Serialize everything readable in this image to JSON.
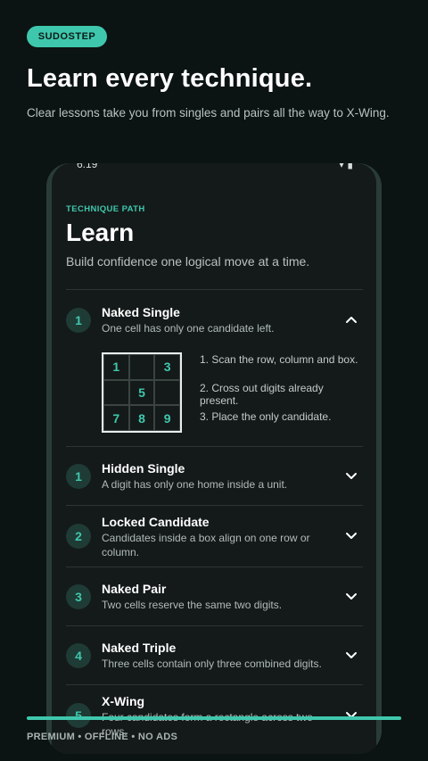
{
  "promo": {
    "badge": "SUDOSTEP",
    "headline": "Learn every technique.",
    "subhead": "Clear lessons take you from singles and pairs all the way to X-Wing.",
    "footer": "PREMIUM • OFFLINE • NO ADS",
    "progress": 1.0
  },
  "status_bar": {
    "time": "6:19",
    "icons": "▾ ▮"
  },
  "screen": {
    "eyebrow": "TECHNIQUE PATH",
    "title": "Learn",
    "subtitle": "Build confidence one logical move at a time.",
    "techniques": [
      {
        "number": "1",
        "title": "Naked Single",
        "description": "One cell has only one candidate left.",
        "expanded": true,
        "grid": [
          "1",
          "",
          "3",
          "",
          "5",
          "",
          "7",
          "8",
          "9"
        ],
        "steps": [
          "1. Scan the row, column and box.",
          "2. Cross out digits already present.",
          "3. Place the only candidate."
        ]
      },
      {
        "number": "1",
        "title": "Hidden Single",
        "description": "A digit has only one home inside a unit.",
        "expanded": false
      },
      {
        "number": "2",
        "title": "Locked Candidate",
        "description": "Candidates inside a box align on one row or column.",
        "expanded": false
      },
      {
        "number": "3",
        "title": "Naked Pair",
        "description": "Two cells reserve the same two digits.",
        "expanded": false
      },
      {
        "number": "4",
        "title": "Naked Triple",
        "description": "Three cells contain only three combined digits.",
        "expanded": false
      },
      {
        "number": "5",
        "title": "X-Wing",
        "description": "Four candidates form a rectangle across two rows.",
        "expanded": false
      }
    ]
  },
  "colors": {
    "accent": "#3fc7ad",
    "background": "#0b1412",
    "card": "#141a19"
  }
}
